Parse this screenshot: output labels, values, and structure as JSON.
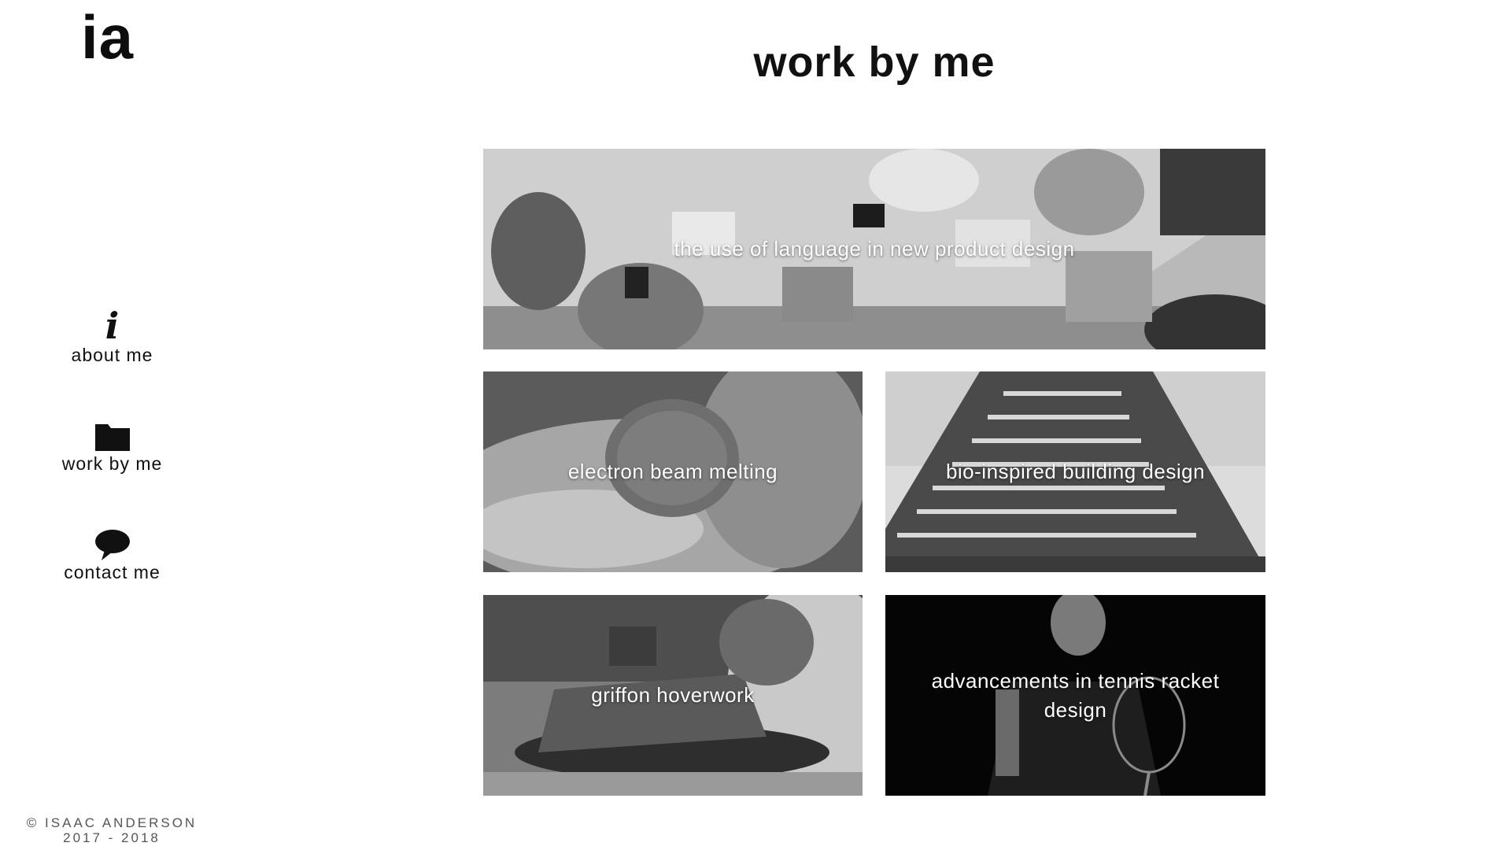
{
  "sidebar": {
    "logo": "ia",
    "nav": [
      {
        "label": "about me",
        "icon": "info-icon",
        "glyph": "i"
      },
      {
        "label": "work by me",
        "icon": "folder-icon"
      },
      {
        "label": "contact me",
        "icon": "speech-bubble-icon"
      }
    ],
    "footer": {
      "line1": "© ISAAC ANDERSON",
      "line2": "2017 - 2018"
    }
  },
  "main": {
    "title": "work by me",
    "projects": [
      {
        "title": "the use of language in new product design"
      },
      {
        "title": "electron beam melting"
      },
      {
        "title": "bio-inspired building design"
      },
      {
        "title": "griffon hoverwork"
      },
      {
        "title": "advancements in tennis racket design"
      }
    ]
  }
}
